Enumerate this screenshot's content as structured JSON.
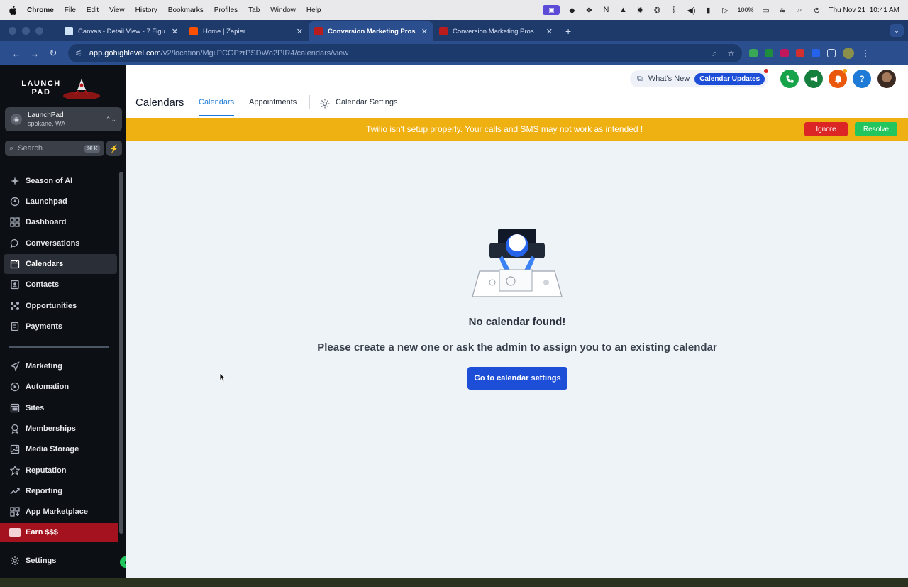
{
  "menubar": {
    "items": [
      "Chrome",
      "File",
      "Edit",
      "View",
      "History",
      "Bookmarks",
      "Profiles",
      "Tab",
      "Window",
      "Help"
    ],
    "battery": "100%",
    "datetime": "Thu Nov 21  10:41 AM"
  },
  "tabs": [
    {
      "title": "Canvas - Detail View - 7 Figu",
      "favicon_color": "#cfe3f6"
    },
    {
      "title": "Home | Zapier",
      "favicon_color": "#ff4f00"
    },
    {
      "title": "Conversion Marketing Pros",
      "favicon_color": "#b91c1c"
    },
    {
      "title": "Conversion Marketing Pros",
      "favicon_color": "#b91c1c"
    }
  ],
  "omnibox": {
    "host": "app.gohighlevel.com",
    "path": "/v2/location/MgilPCGPzrPSDWo2PIR4/calendars/view"
  },
  "sidebar": {
    "logo_text": "LAUNCH PAD",
    "location_name": "LaunchPad",
    "location_sub": "spokane, WA",
    "search_placeholder": "Search",
    "search_shortcut": "⌘ K",
    "items": [
      {
        "label": "Season of AI",
        "icon": "sparkle-icon"
      },
      {
        "label": "Launchpad",
        "icon": "rocket-icon"
      },
      {
        "label": "Dashboard",
        "icon": "grid-icon"
      },
      {
        "label": "Conversations",
        "icon": "chat-icon"
      },
      {
        "label": "Calendars",
        "icon": "calendar-icon"
      },
      {
        "label": "Contacts",
        "icon": "contacts-icon"
      },
      {
        "label": "Opportunities",
        "icon": "opportunities-icon"
      },
      {
        "label": "Payments",
        "icon": "payments-icon"
      },
      {
        "label": "Marketing",
        "icon": "send-icon"
      },
      {
        "label": "Automation",
        "icon": "automation-icon"
      },
      {
        "label": "Sites",
        "icon": "sites-icon"
      },
      {
        "label": "Memberships",
        "icon": "badge-icon"
      },
      {
        "label": "Media Storage",
        "icon": "image-icon"
      },
      {
        "label": "Reputation",
        "icon": "star-icon"
      },
      {
        "label": "Reporting",
        "icon": "trend-icon"
      },
      {
        "label": "App Marketplace",
        "icon": "apps-icon"
      }
    ],
    "earn_label": "Earn $$$",
    "settings_label": "Settings"
  },
  "header": {
    "whats_new": "What's New",
    "calendar_updates": "Calendar Updates",
    "page_title": "Calendars",
    "tabs": [
      "Calendars",
      "Appointments",
      "Calendar Settings"
    ],
    "help_glyph": "?"
  },
  "banner": {
    "message": "Twilio isn't setup properly. Your calls and SMS may not work as intended !",
    "ignore": "Ignore",
    "resolve": "Resolve"
  },
  "empty_state": {
    "title": "No calendar found!",
    "subtitle": "Please create a new one or ask the admin to assign you to an existing calendar",
    "button": "Go to calendar settings"
  },
  "colors": {
    "primary": "#1d4ed8",
    "banner": "#efb012",
    "ignore": "#dc2626",
    "resolve": "#22c55e"
  }
}
